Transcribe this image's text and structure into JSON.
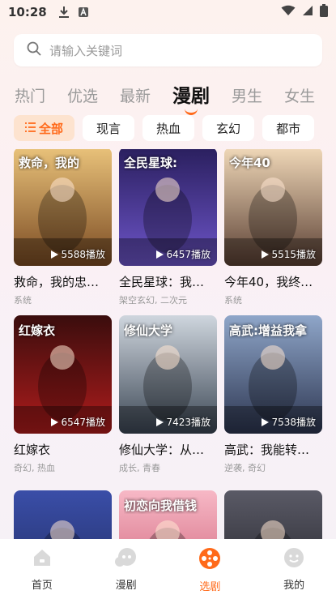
{
  "status_bar": {
    "time": "10:28"
  },
  "search": {
    "placeholder": "请输入关键词"
  },
  "tabs": [
    {
      "label": "热门",
      "active": false
    },
    {
      "label": "优选",
      "active": false
    },
    {
      "label": "最新",
      "active": false
    },
    {
      "label": "漫剧",
      "active": true
    },
    {
      "label": "男生",
      "active": false
    },
    {
      "label": "女生",
      "active": false
    }
  ],
  "chips": [
    {
      "label": "全部",
      "active": true
    },
    {
      "label": "现言",
      "active": false
    },
    {
      "label": "热血",
      "active": false
    },
    {
      "label": "玄幻",
      "active": false
    },
    {
      "label": "都市",
      "active": false
    }
  ],
  "cards": [
    {
      "title": "救命，我的忠…",
      "plays": "5588播放",
      "tags": "系统",
      "cover_text": "救命，我的",
      "cover_bg": [
        "#e9c27a",
        "#7a4a22"
      ]
    },
    {
      "title": "全民星球：我…",
      "plays": "6457播放",
      "tags": "架空玄幻, 二次元",
      "cover_text": "全民星球:",
      "cover_bg": [
        "#2a1f5e",
        "#6d55c9"
      ]
    },
    {
      "title": "今年40，我终…",
      "plays": "5515播放",
      "tags": "系统",
      "cover_text": "今年40",
      "cover_bg": [
        "#f0d8b8",
        "#5a3f33"
      ]
    },
    {
      "title": "红嫁衣",
      "plays": "6547播放",
      "tags": "奇幻, 热血",
      "cover_text": "红嫁衣",
      "cover_bg": [
        "#3a0d0d",
        "#b01c1c"
      ]
    },
    {
      "title": "修仙大学：从…",
      "plays": "7423播放",
      "tags": "成长, 青春",
      "cover_text": "修仙大学",
      "cover_bg": [
        "#cfd6de",
        "#3b4654"
      ]
    },
    {
      "title": "高武：我能转…",
      "plays": "7538播放",
      "tags": "逆袭, 奇幻",
      "cover_text": "高武:增益我拿",
      "cover_bg": [
        "#8fa6c9",
        "#2c3550"
      ]
    },
    {
      "title": "",
      "plays": "",
      "tags": "",
      "cover_text": "",
      "cover_bg": [
        "#3a4ea8",
        "#1f2a5c"
      ]
    },
    {
      "title": "",
      "plays": "",
      "tags": "",
      "cover_text": "初恋向我借钱",
      "cover_bg": [
        "#f7b8c6",
        "#c9566e"
      ]
    },
    {
      "title": "",
      "plays": "",
      "tags": "",
      "cover_text": "",
      "cover_bg": [
        "#5a5a66",
        "#1e1e24"
      ]
    }
  ],
  "bottom_nav": [
    {
      "label": "首页",
      "icon": "home-icon",
      "active": false
    },
    {
      "label": "漫剧",
      "icon": "comic-icon",
      "active": false
    },
    {
      "label": "选剧",
      "icon": "film-reel-icon",
      "active": true
    },
    {
      "label": "我的",
      "icon": "profile-icon",
      "active": false
    }
  ],
  "colors": {
    "accent": "#ff6a1a",
    "chip_active_bg": "#fde3cf"
  }
}
